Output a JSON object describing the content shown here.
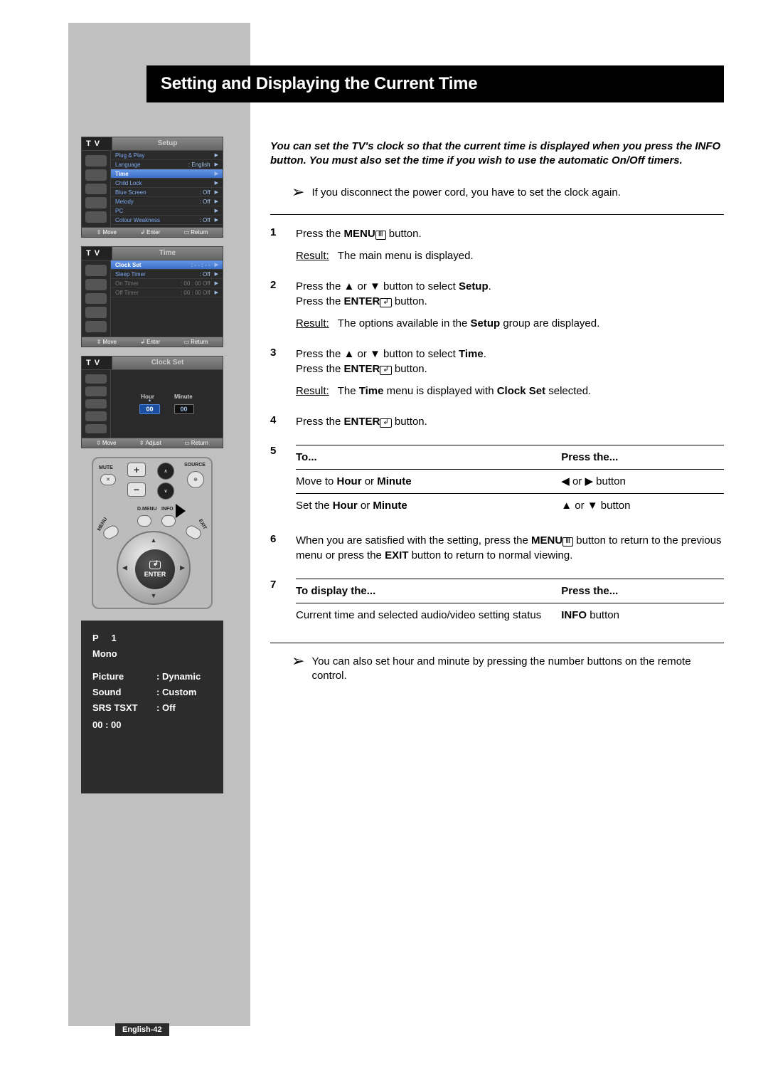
{
  "title": "Setting and Displaying the Current Time",
  "intro": "You can set the TV's clock so that the current time is displayed when you press the INFO button. You must also set the time if you wish to use the automatic On/Off timers.",
  "power_note": "If you disconnect the power cord, you have to set the clock again.",
  "final_note": "You can also set hour and minute by pressing the number buttons on the remote control.",
  "page_label": "English-42",
  "osd": {
    "tv_label": "T V",
    "setup": {
      "title": "Setup",
      "rows": [
        {
          "label": "Plug & Play",
          "value": "",
          "arrow": true
        },
        {
          "label": "Language",
          "value": ": English",
          "arrow": true
        },
        {
          "label": "Time",
          "value": "",
          "arrow": true,
          "highlight": true
        },
        {
          "label": "Child Lock",
          "value": "",
          "arrow": true
        },
        {
          "label": "Blue Screen",
          "value": ": Off",
          "arrow": true
        },
        {
          "label": "Melody",
          "value": ": Off",
          "arrow": true
        },
        {
          "label": "PC",
          "value": "",
          "arrow": true
        },
        {
          "label": "Colour Weakness",
          "value": ": Off",
          "arrow": true
        }
      ],
      "footer": {
        "move": "Move",
        "enter": "Enter",
        "return": "Return"
      }
    },
    "time": {
      "title": "Time",
      "rows": [
        {
          "label": "Clock Set",
          "value": ":   - - : - -",
          "arrow": true,
          "highlight": true
        },
        {
          "label": "Sleep Timer",
          "value": ":   Off",
          "arrow": true
        },
        {
          "label": "On Timer",
          "value": ":   00 : 00     Off",
          "arrow": true,
          "disabled": true
        },
        {
          "label": "Off Timer",
          "value": ":   00 : 00     Off",
          "arrow": true,
          "disabled": true
        }
      ],
      "footer": {
        "move": "Move",
        "enter": "Enter",
        "return": "Return"
      }
    },
    "clock_set": {
      "title": "Clock Set",
      "hour_label": "Hour",
      "minute_label": "Minute",
      "hour_value": "00",
      "minute_value": "00",
      "footer": {
        "move": "Move",
        "adjust": "Adjust",
        "return": "Return"
      }
    }
  },
  "remote": {
    "mute": "MUTE",
    "source": "SOURCE",
    "dmenu": "D.MENU",
    "info": "INFO",
    "menu": "MENU",
    "exit": "EXIT",
    "enter": "ENTER"
  },
  "info_panel": {
    "p": "P     1",
    "mono": "Mono",
    "picture_k": "Picture",
    "picture_v": "Dynamic",
    "sound_k": "Sound",
    "sound_v": "Custom",
    "srs_k": "SRS TSXT",
    "srs_v": "Off",
    "time": "00 : 00"
  },
  "steps": {
    "1": {
      "line1a": "Press the ",
      "line1b": "MENU",
      "line1c": " button.",
      "result": "The main menu is displayed."
    },
    "2": {
      "line1a": "Press the ▲ or ▼ button to select ",
      "line1b": "Setup",
      "line1c": ".",
      "line2a": "Press the ",
      "line2b": "ENTER",
      "line2c": " button.",
      "resulta": "The options available in the ",
      "resultb": "Setup",
      "resultc": " group are displayed."
    },
    "3": {
      "line1a": "Press the ▲ or ▼ button to select ",
      "line1b": "Time",
      "line1c": ".",
      "line2a": "Press the ",
      "line2b": "ENTER",
      "line2c": " button.",
      "resulta": "The ",
      "resultb": "Time",
      "resultc": " menu is displayed with ",
      "resultd": "Clock Set",
      "resulte": " selected."
    },
    "4": {
      "line1a": "Press the ",
      "line1b": "ENTER",
      "line1c": " button."
    },
    "5": {
      "h1": "To...",
      "h2": "Press the...",
      "r1a": "Move to ",
      "r1b": "Hour",
      "r1c": " or ",
      "r1d": "Minute",
      "r1v": "◀ or ▶ button",
      "r2a": "Set the ",
      "r2b": "Hour",
      "r2c": " or ",
      "r2d": "Minute",
      "r2v": "▲ or ▼ button"
    },
    "6": {
      "a": "When you are satisfied with the setting, press the ",
      "b": "MENU",
      "c": " button to return to the previous menu or press the ",
      "d": "EXIT",
      "e": " button to return to normal viewing."
    },
    "7": {
      "h1": "To display the...",
      "h2": "Press the...",
      "r1k": "Current time and selected audio/video setting status",
      "r1va": "INFO",
      "r1vb": " button"
    }
  },
  "labels": {
    "result": "Result"
  }
}
